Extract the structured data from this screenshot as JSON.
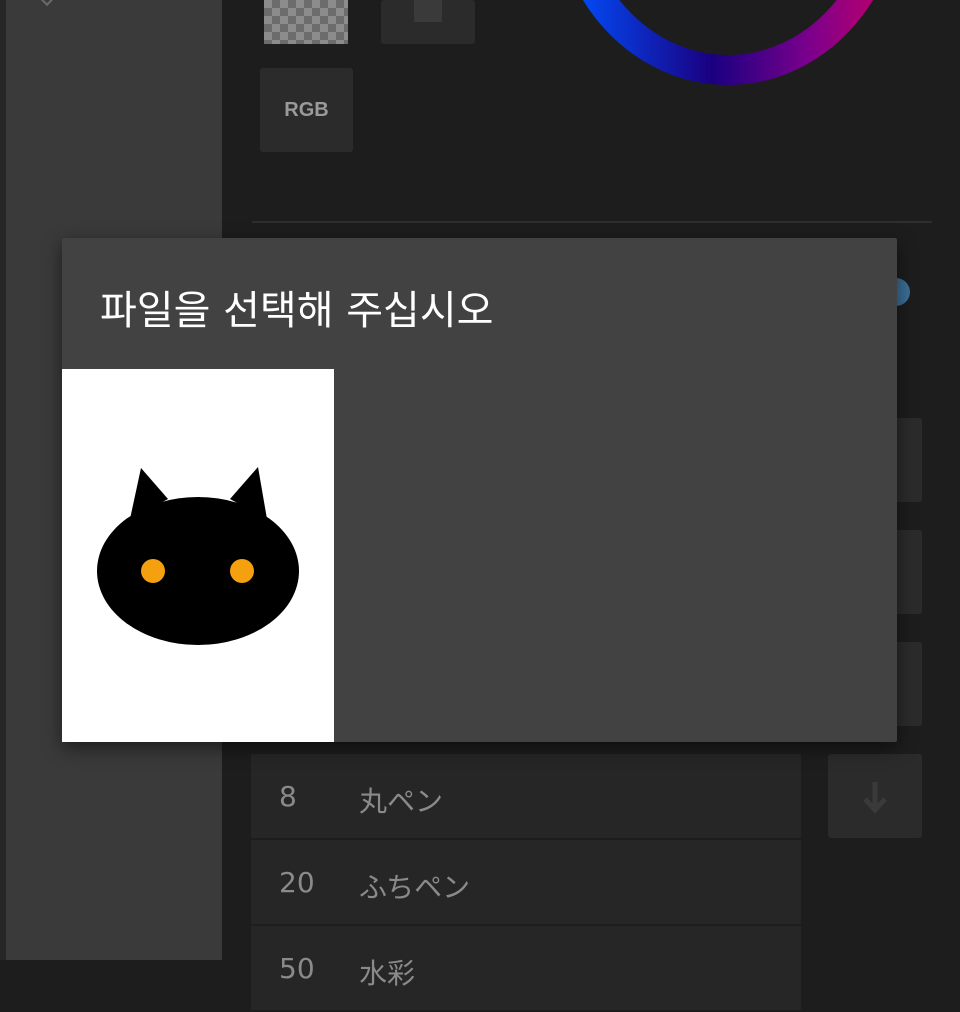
{
  "color_panel": {
    "mode_button_label": "RGB"
  },
  "pen_list": {
    "rows": [
      {
        "size": "8",
        "name": "丸ペン"
      },
      {
        "size": "20",
        "name": "ふちペン"
      },
      {
        "size": "50",
        "name": "水彩"
      }
    ]
  },
  "dialog": {
    "title": "파일을 선택해 주십시오",
    "files": [
      {
        "icon": "black-cat-icon"
      }
    ]
  },
  "colors": {
    "background": "#1d1d1d",
    "dialog_bg": "#424242",
    "cat_eye": "#f5a00f"
  }
}
